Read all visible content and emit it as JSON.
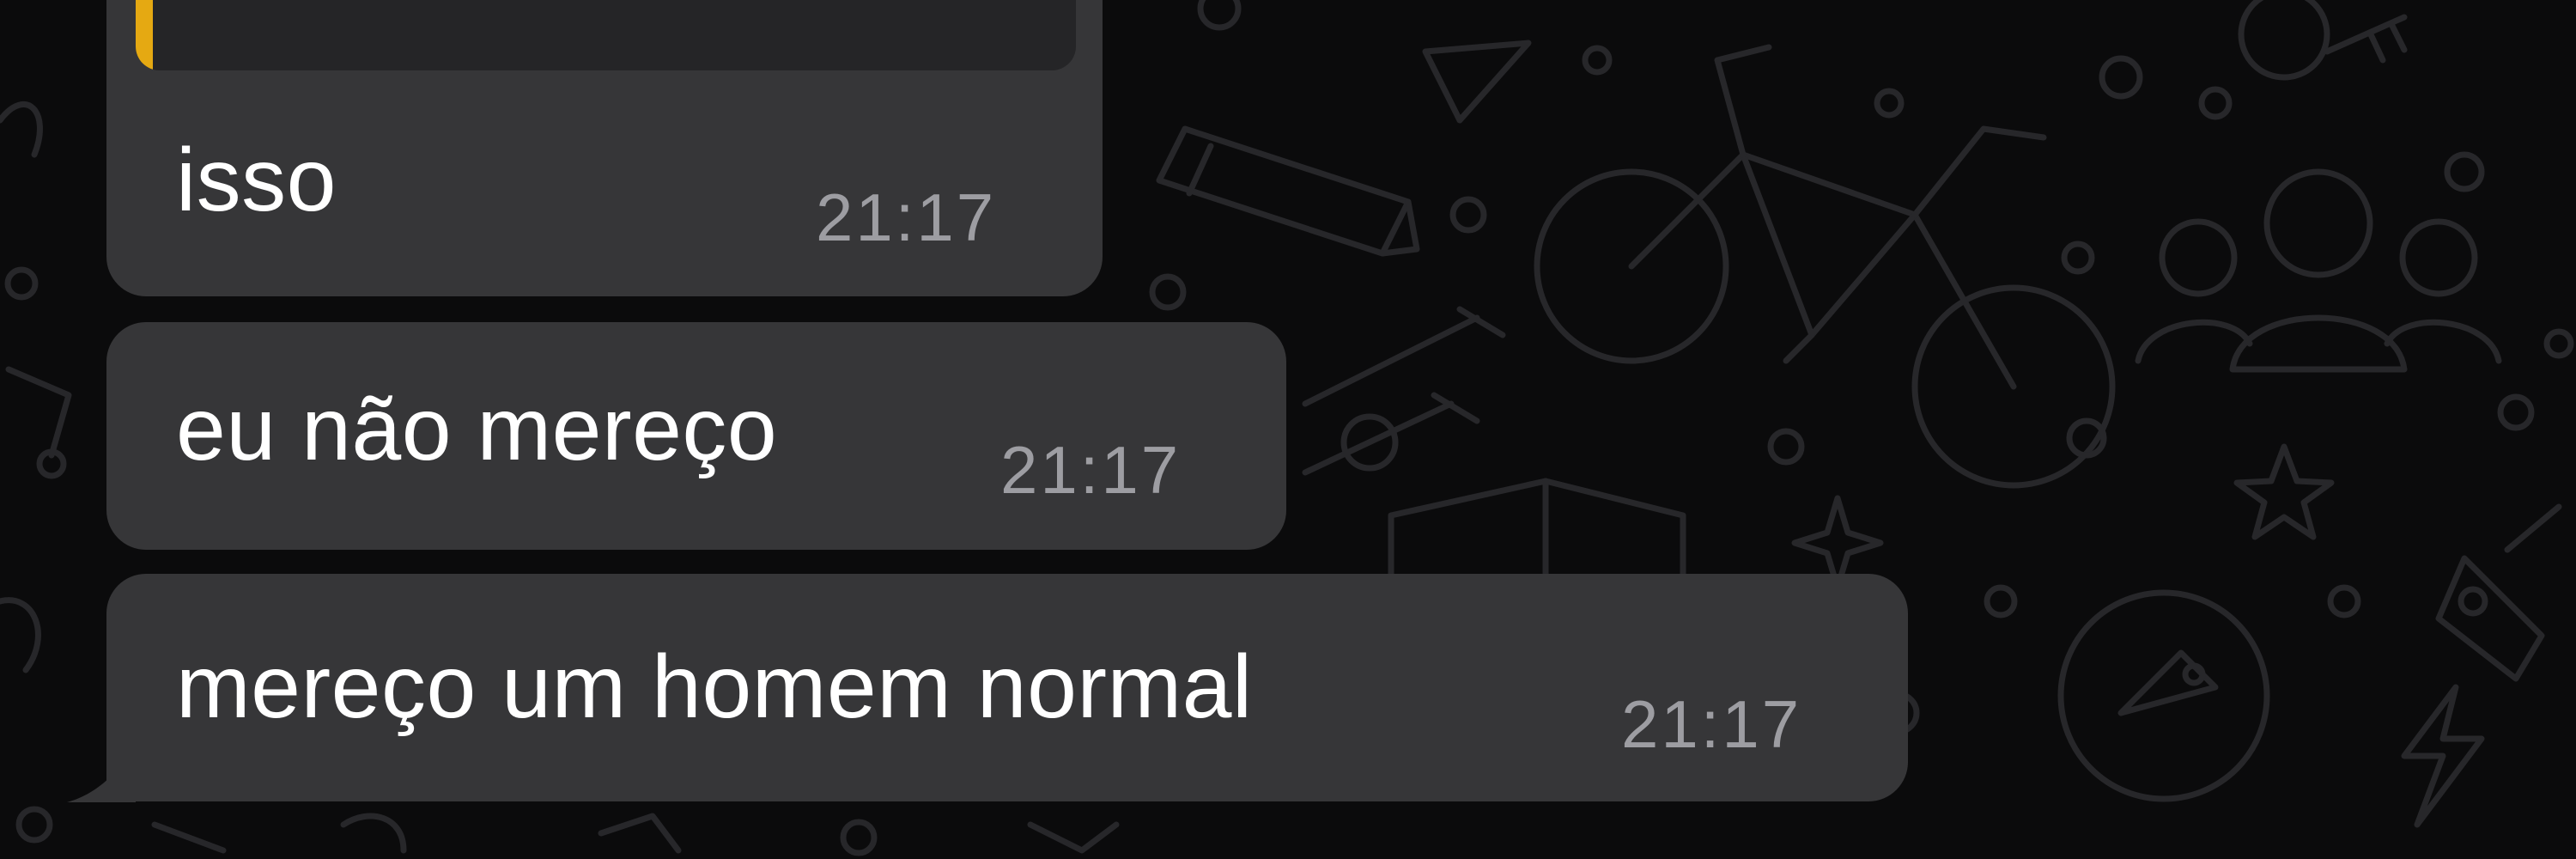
{
  "chat": {
    "messages": [
      {
        "text": "isso",
        "time": "21:17",
        "has_reply_quote": true,
        "reply_accent_color": "#e5a912"
      },
      {
        "text": "eu não mereço",
        "time": "21:17"
      },
      {
        "text": "mereço um homem normal",
        "time": "21:17"
      }
    ],
    "colors": {
      "background": "#0b0b0c",
      "bubble": "#363638",
      "text": "#ffffff",
      "timestamp": "#9d9da2",
      "wallpaper_doodle": "#27272a"
    },
    "wallpaper_icons": [
      "bicycle-icon",
      "pencil-icon",
      "people-icon",
      "star-icon",
      "key-icon",
      "guitar-icon",
      "bird-icon",
      "lightning-icon",
      "book-icon",
      "sparkle-icon"
    ]
  }
}
